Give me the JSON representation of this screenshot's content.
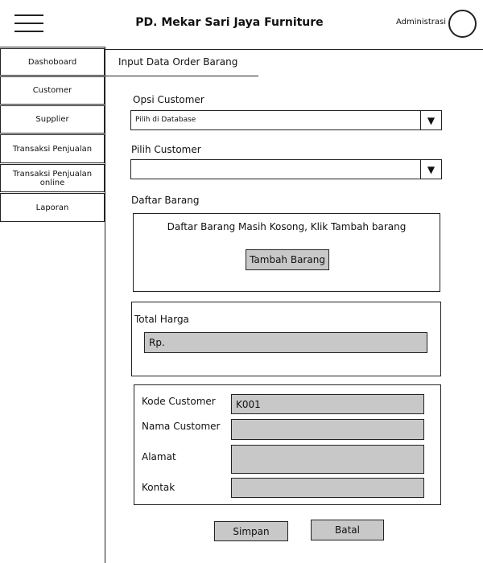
{
  "header": {
    "title": "PD. Mekar Sari Jaya Furniture",
    "user": "Administrasi"
  },
  "sidebar": {
    "items": [
      {
        "label": "Dashoboard"
      },
      {
        "label": "Customer"
      },
      {
        "label": "Supplier"
      },
      {
        "label": "Transaksi Penjualan"
      },
      {
        "label": "Transaksi Penjualan online"
      },
      {
        "label": "Laporan"
      }
    ]
  },
  "form": {
    "section_title": "Input Data Order Barang",
    "opsi_customer": {
      "label": "Opsi Customer",
      "value": "Pilih di Database"
    },
    "pilih_customer": {
      "label": "Pilih Customer",
      "value": ""
    },
    "daftar_barang": {
      "label": "Daftar Barang",
      "empty_message": "Daftar Barang Masih Kosong, Klik Tambah barang",
      "add_button": "Tambah Barang"
    },
    "total": {
      "label": "Total Harga",
      "value": "Rp."
    },
    "customer_info": {
      "kode": {
        "label": "Kode Customer",
        "value": "K001"
      },
      "nama": {
        "label": "Nama Customer",
        "value": ""
      },
      "alamat": {
        "label": "Alamat",
        "value": ""
      },
      "kontak": {
        "label": "Kontak",
        "value": ""
      }
    },
    "save_button": "Simpan",
    "cancel_button": "Batal"
  },
  "icons": {
    "menu": "hamburger-menu-icon",
    "user": "user-avatar-icon",
    "dropdown": "triangle-down-icon"
  }
}
